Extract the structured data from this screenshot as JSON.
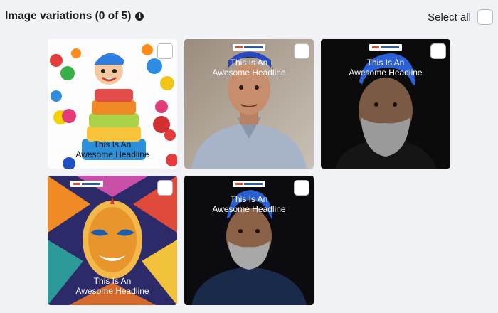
{
  "header": {
    "title": "Image variations (0 of 5)",
    "info_icon": "info-icon",
    "select_all_label": "Select all"
  },
  "tiles": [
    {
      "id": "cartoon-cake",
      "headline_line1": "This Is An",
      "headline_line2": "Awesome Headline",
      "selected": false
    },
    {
      "id": "young-man",
      "headline_line1": "This Is An",
      "headline_line2": "Awesome Headline",
      "selected": false
    },
    {
      "id": "bearded-man-cap",
      "headline_line1": "This Is An",
      "headline_line2": "Awesome Headline",
      "selected": false
    },
    {
      "id": "psychedelic-mask",
      "headline_line1": "This Is An",
      "headline_line2": "Awesome Headline",
      "selected": false
    },
    {
      "id": "grey-beard-man",
      "headline_line1": "This Is An",
      "headline_line2": "Awesome Headline",
      "selected": false
    }
  ]
}
